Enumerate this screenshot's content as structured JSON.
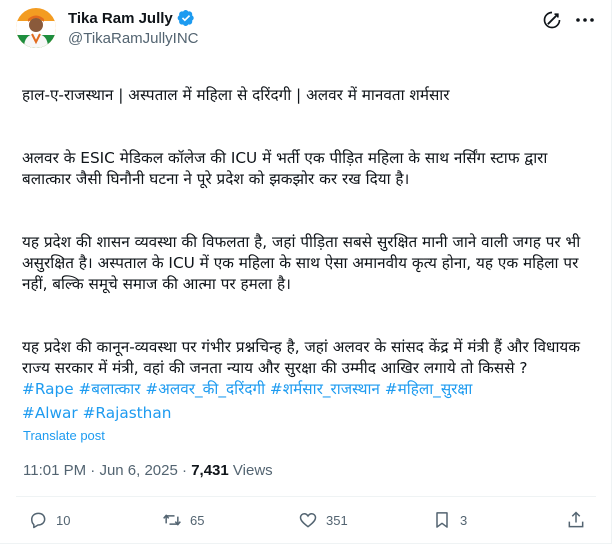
{
  "author": {
    "name": "Tika Ram Jully",
    "handle": "@TikaRamJullyINC",
    "verified_icon": "verified-badge-icon",
    "avatar_colors": [
      "#f39c22",
      "#ffffff",
      "#1e8e3e"
    ]
  },
  "tweet": {
    "paragraphs": [
      "हाल-ए-राजस्थान | अस्पताल में महिला से दरिंदगी | अलवर में मानवता शर्मसार",
      "अलवर के ESIC मेडिकल कॉलेज की ICU में भर्ती एक पीड़ित महिला के साथ नर्सिंग स्टाफ द्वारा बलात्कार जैसी घिनौनी घटना ने पूरे प्रदेश को झकझोर कर रख दिया है।",
      "यह प्रदेश की शासन व्यवस्था की विफलता है, जहां पीड़िता सबसे सुरक्षित मानी जाने वाली जगह पर भी असुरक्षित है। अस्पताल के ICU में एक महिला के साथ ऐसा अमानवीय कृत्य होना, यह एक महिला पर नहीं, बल्कि समूचे समाज की आत्मा पर हमला है।",
      "यह प्रदेश की कानून-व्यवस्था पर गंभीर प्रश्नचिन्ह है, जहां अलवर के सांसद केंद्र में मंत्री हैं और विधायक राज्य सरकार में मंत्री, वहां की जनता न्याय और सुरक्षा की उम्मीद आखिर लगाये तो किससे ?"
    ],
    "hashtags": [
      "#Rape",
      "#बलात्कार",
      "#अलवर_की_दरिंदगी",
      "#शर्मसार_राजस्थान",
      "#महिला_सुरक्षा",
      "#Alwar",
      "#Rajasthan"
    ],
    "translate_label": "Translate post",
    "time": "11:01 PM",
    "separator": "·",
    "date": "Jun 6, 2025",
    "views_count": "7,431",
    "views_label": "Views"
  },
  "actions": {
    "replies": "10",
    "reposts": "65",
    "likes": "351",
    "bookmarks": "3"
  },
  "colors": {
    "accent": "#1d9bf0",
    "text": "#0f1419",
    "secondary": "#536471"
  }
}
